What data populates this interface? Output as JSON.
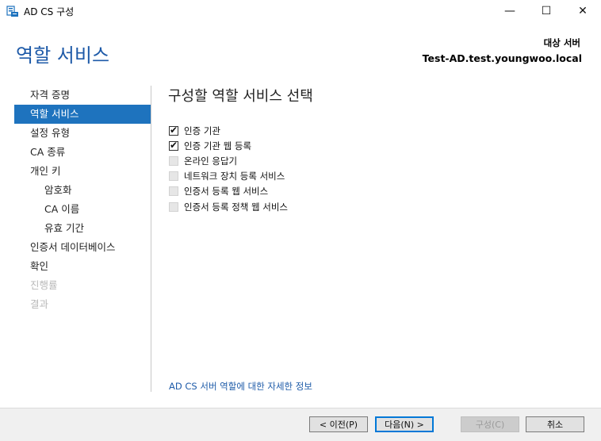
{
  "window": {
    "title": "AD CS 구성",
    "controls": {
      "minimize": "—",
      "maximize": "☐",
      "close": "✕"
    }
  },
  "header": {
    "title": "역할 서비스",
    "target_label": "대상 서버",
    "target_server": "Test-AD.test.youngwoo.local"
  },
  "nav": {
    "items": [
      {
        "label": "자격 증명",
        "state": "normal",
        "indent": false
      },
      {
        "label": "역할 서비스",
        "state": "selected",
        "indent": false
      },
      {
        "label": "설정 유형",
        "state": "normal",
        "indent": false
      },
      {
        "label": "CA 종류",
        "state": "normal",
        "indent": false
      },
      {
        "label": "개인 키",
        "state": "normal",
        "indent": false
      },
      {
        "label": "암호화",
        "state": "normal",
        "indent": true
      },
      {
        "label": "CA 이름",
        "state": "normal",
        "indent": true
      },
      {
        "label": "유효 기간",
        "state": "normal",
        "indent": true
      },
      {
        "label": "인증서 데이터베이스",
        "state": "normal",
        "indent": false
      },
      {
        "label": "확인",
        "state": "normal",
        "indent": false
      },
      {
        "label": "진행률",
        "state": "disabled",
        "indent": false
      },
      {
        "label": "결과",
        "state": "disabled",
        "indent": false
      }
    ]
  },
  "main": {
    "section_title": "구성할 역할 서비스 선택",
    "roles": [
      {
        "label": "인증 기관",
        "checked": true,
        "enabled": true
      },
      {
        "label": "인증 기관 웹 등록",
        "checked": true,
        "enabled": true
      },
      {
        "label": "온라인 응답기",
        "checked": false,
        "enabled": false
      },
      {
        "label": "네트워크 장치 등록 서비스",
        "checked": false,
        "enabled": false
      },
      {
        "label": "인증서 등록 웹 서비스",
        "checked": false,
        "enabled": false
      },
      {
        "label": "인증서 등록 정책 웹 서비스",
        "checked": false,
        "enabled": false
      }
    ],
    "more_info_link": "AD CS 서버 역할에 대한 자세한 정보"
  },
  "footer": {
    "prev_label": "< 이전(P)",
    "next_label": "다음(N) >",
    "configure_label": "구성(C)",
    "cancel_label": "취소"
  },
  "colors": {
    "accent": "#1e73be",
    "header_title": "#1e5aa8",
    "link": "#1f5ca9"
  }
}
